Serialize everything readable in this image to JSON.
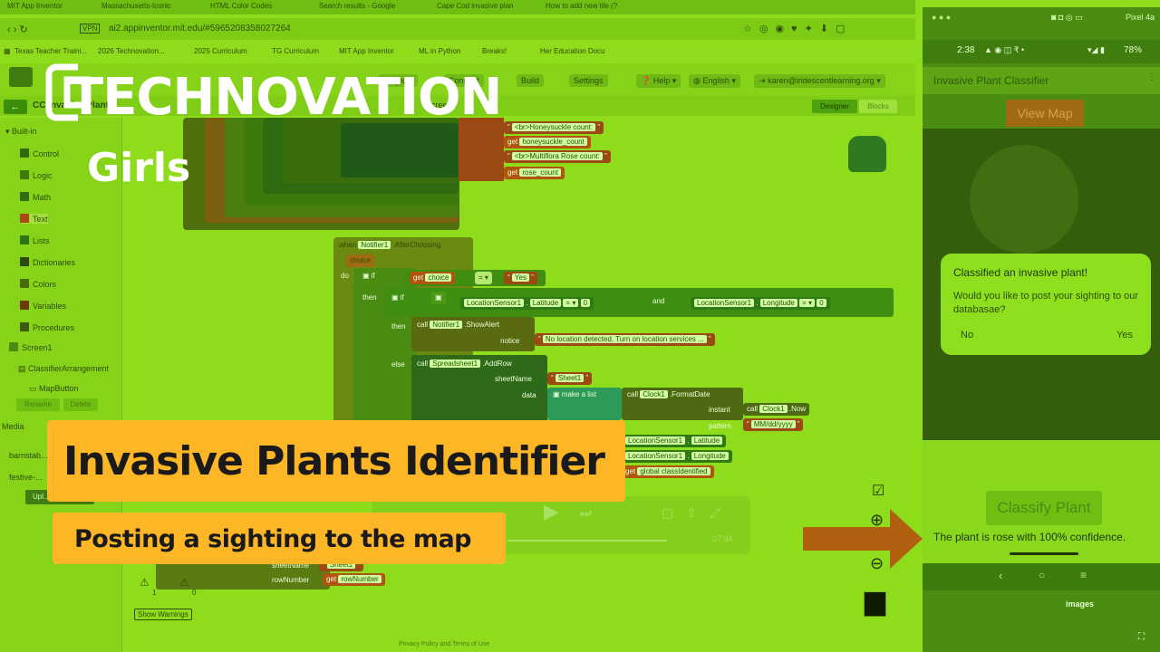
{
  "browser": {
    "tabs": [
      "MIT App Inventor",
      "Massachusetts-Iconic",
      "HTML Color Codes",
      "Search results - Google",
      "Cape Cod invasive plan",
      "How to add new tile (?"
    ],
    "url": "ai2.appinventor.mit.edu/#5965208358027264",
    "bookmarks": [
      "Texas Teacher Traini...",
      "2026 Technovation...",
      "2025 Curriculum",
      "TG Curriculum",
      "MIT App Inventor",
      "ML in Python",
      "Breaks!",
      "Her Education Docu"
    ]
  },
  "app_header": {
    "menus": [
      "Projects",
      "Connect",
      "Build",
      "Settings"
    ],
    "help": "Help",
    "language": "English",
    "account": "karen@iridescentlearning.org",
    "project": "CC Invasive Plant",
    "screen": "Screen1",
    "designer": "Designer",
    "blocks": "Blocks"
  },
  "sidebar": {
    "builtin": "Built-in",
    "items": [
      "Control",
      "Logic",
      "Math",
      "Text",
      "Lists",
      "Dictionaries",
      "Colors",
      "Variables",
      "Procedures"
    ],
    "item_colors": [
      "#2f6a0c",
      "#3e7a0a",
      "#2c6f12",
      "#a84a12",
      "#2d7516",
      "#2a4a10",
      "#4a6a0a",
      "#6a3a0a",
      "#3a5a12"
    ],
    "tree": [
      "Screen1",
      "ClassifierArrangement",
      "MapButton"
    ],
    "rename": "Rename",
    "delete": "Delete",
    "media_label": "Media",
    "media": [
      "barnstab...",
      "festive-..."
    ],
    "upload": "Upl..."
  },
  "blocks": {
    "top_texts": [
      "<br>Honeysuckle count:",
      "honeysuckle_count",
      "<br>Multiflora Rose count:",
      "rose_count"
    ],
    "when": "when",
    "notifier": "Notifier1",
    "after": ".AfterChoosing",
    "choice": "choice",
    "do": "do",
    "if": "if",
    "get": "get",
    "yes_text": "Yes",
    "then": "then",
    "location": "LocationSensor1",
    "latitude": "Latitude",
    "longitude": "Longitude",
    "zero": "0",
    "and": "and",
    "call": "call",
    "show_alert": ".ShowAlert",
    "notice": "notice",
    "no_location": "No location detected. Turn on location services ...",
    "else": "else",
    "spreadsheet": "Spreadsheet1",
    "add_row": ".AddRow",
    "sheet_name_label": "sheetName",
    "sheet1": "Sheet1",
    "data_label": "data",
    "make_list": "make a list",
    "clock": "Clock1",
    "format_date": ".FormatDate",
    "instant": "instant",
    "now": ".Now",
    "pattern": "pattern",
    "date_pattern": "MM/dd/yyyy",
    "class_identified": "global classIdentified",
    "row_number_label": "rowNumber",
    "row_number": "rowNumber",
    "show_warnings": "Show Warnings",
    "warn_count1": "1",
    "warn_count2": "0",
    "video_time": "07:34",
    "footer": "Privacy Policy and Terms of Use"
  },
  "phone": {
    "window_label": "Pixel 4a",
    "time": "2:38",
    "battery": "78%",
    "app_title": "Invasive Plant Classifier",
    "view_map": "View Map",
    "dialog_title": "Classified an invasive plant!",
    "dialog_body": "Would you like to post your sighting to our databasae?",
    "no": "No",
    "yes": "Yes",
    "classify": "Classify Plant",
    "result": "The plant is rose with 100% confidence.",
    "images_label": "images"
  },
  "overlay": {
    "logo_main": "TECHNOVATION",
    "logo_sub": "Girls",
    "title": "Invasive Plants Identifier",
    "subtitle": "Posting a sighting to the map"
  }
}
